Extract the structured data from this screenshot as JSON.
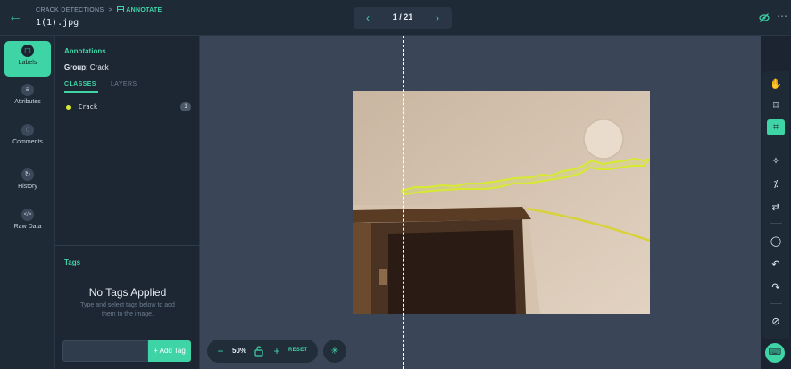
{
  "header": {
    "breadcrumb_project": "CRACK DETECTIONS",
    "breadcrumb_sep": ">",
    "breadcrumb_current": "ANNOTATE",
    "filename": "1(1).jpg",
    "pager": {
      "prev": "‹",
      "count": "1 / 21",
      "next": "›"
    }
  },
  "leftnav": {
    "items": [
      {
        "label": "Labels",
        "icon": "tag-icon",
        "glyph": "▢",
        "active": true
      },
      {
        "label": "Attributes",
        "icon": "list-icon",
        "glyph": "≡"
      },
      {
        "label": "Comments",
        "icon": "comment-icon",
        "glyph": "◌"
      },
      {
        "label": "History",
        "icon": "history-icon",
        "glyph": "↻"
      },
      {
        "label": "Raw Data",
        "icon": "code-icon",
        "glyph": "</>"
      }
    ]
  },
  "panel": {
    "title": "Annotations",
    "group_label": "Group:",
    "group_value": "Crack",
    "tabs": {
      "classes": "CLASSES",
      "layers": "LAYERS"
    },
    "classes": [
      {
        "name": "Crack",
        "count": "1",
        "color": "#d7ea32"
      }
    ],
    "tags": {
      "title": "Tags",
      "empty_title": "No Tags Applied",
      "empty_sub": "Type and select tags below to add them to the image.",
      "add_button": "+ Add Tag",
      "input_value": ""
    }
  },
  "canvas": {
    "zoom": {
      "minus": "−",
      "level": "50%",
      "plus": "+",
      "reset": "RESET"
    }
  },
  "toolbar": {
    "tools": [
      {
        "icon": "hand-icon",
        "glyph": "✋"
      },
      {
        "icon": "bbox-icon",
        "glyph": "⌑"
      },
      {
        "icon": "polygon-icon",
        "glyph": "⌗",
        "active": true
      },
      {
        "icon": "magic-select-icon",
        "glyph": "✧"
      },
      {
        "icon": "magic-wand-icon",
        "glyph": "⁒"
      },
      {
        "icon": "sync-icon",
        "glyph": "⇄"
      },
      {
        "icon": "lasso-icon",
        "glyph": "◯"
      },
      {
        "icon": "undo-icon",
        "glyph": "↶"
      },
      {
        "icon": "redo-icon",
        "glyph": "↷"
      },
      {
        "icon": "clear-icon",
        "glyph": "⊘"
      }
    ]
  },
  "colors": {
    "accent": "#3ed4a6",
    "background": "#1b2430",
    "canvas": "#3a4657",
    "crack_annotation": "#d7ea32"
  }
}
